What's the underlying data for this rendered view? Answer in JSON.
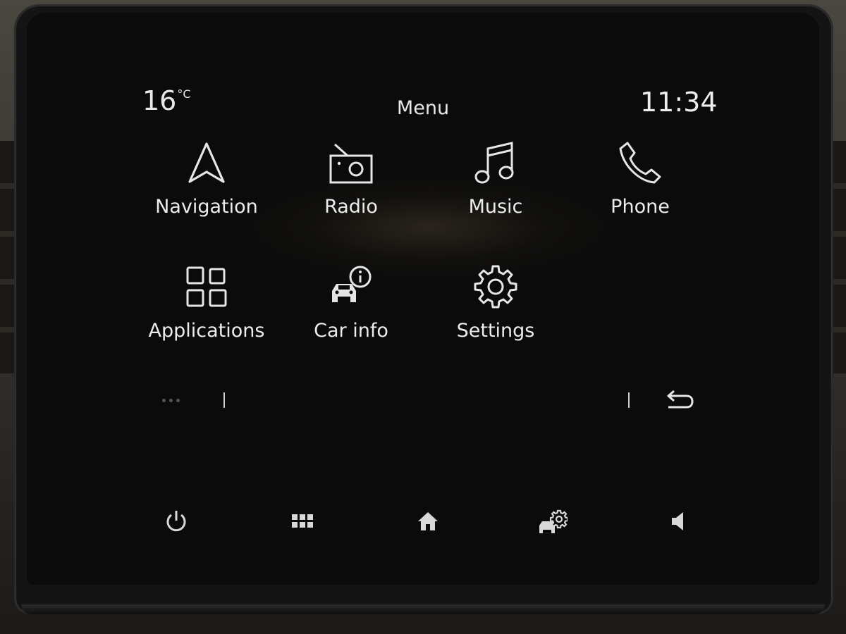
{
  "status_bar": {
    "temperature": "16",
    "temperature_unit": "°C",
    "title": "Menu",
    "clock": "11:34"
  },
  "menu": {
    "items": [
      {
        "label": "Navigation",
        "icon": "navigation-arrow-icon"
      },
      {
        "label": "Radio",
        "icon": "radio-icon"
      },
      {
        "label": "Music",
        "icon": "music-note-icon"
      },
      {
        "label": "Phone",
        "icon": "phone-handset-icon"
      },
      {
        "label": "Applications",
        "icon": "apps-grid-icon"
      },
      {
        "label": "Car info",
        "icon": "car-info-icon"
      },
      {
        "label": "Settings",
        "icon": "gear-icon"
      }
    ]
  },
  "footer_bar": {
    "page_dots": 3,
    "back_icon": "back-arrow-icon"
  },
  "hardware_buttons": [
    {
      "icon": "power-icon"
    },
    {
      "icon": "grid-menu-icon"
    },
    {
      "icon": "home-icon"
    },
    {
      "icon": "car-settings-icon"
    },
    {
      "icon": "speaker-icon"
    }
  ],
  "colors": {
    "text": "#ececec",
    "icon": "#e6e6e6",
    "screen_bg": "#0b0b0b"
  }
}
